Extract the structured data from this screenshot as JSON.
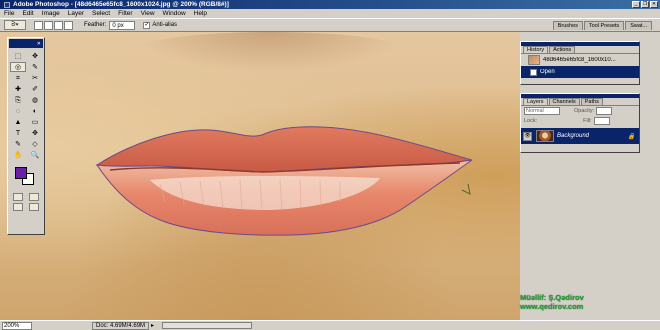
{
  "window": {
    "title": "Adobe Photoshop - [48d6465e65fc8_1600x1024.jpg @ 200% (RGB/8#)]",
    "buttons": [
      "_",
      "❐",
      "✕"
    ]
  },
  "menu": [
    "File",
    "Edit",
    "Image",
    "Layer",
    "Select",
    "Filter",
    "View",
    "Window",
    "Help"
  ],
  "options_bar": {
    "feather_label": "Feather:",
    "feather_value": "0 px",
    "antialias_label": "Anti-alias",
    "antialias_checked": "✓",
    "well_tabs": [
      "Brushes",
      "Tool Presets",
      "Swat..."
    ]
  },
  "toolbox": {
    "tools": [
      "⬚",
      "✥",
      "◎",
      "✎",
      "⌗",
      "✂",
      "✚",
      "✐",
      "⎘",
      "◍",
      "◌",
      "◐",
      "▲",
      "▭",
      "T",
      "✥",
      "✎",
      "◇",
      "✋",
      "🔍"
    ],
    "foreground_color": "#6a1fa8",
    "background_color": "#ffffff"
  },
  "history": {
    "tabs": [
      "History",
      "Actions"
    ],
    "snapshot_label": "48d6465e65fc8_1600x10...",
    "items": [
      {
        "label": "Open"
      }
    ]
  },
  "layers": {
    "tabs": [
      "Layers",
      "Channels",
      "Paths"
    ],
    "blend_mode": "Normal",
    "opacity_label": "Opacity:",
    "lock_label": "Lock:",
    "fill_label": "Fill:",
    "layer_name": "Background",
    "lock_glyph": "🔒"
  },
  "status_bar": {
    "zoom": "200%",
    "doc": "Doc: 4.69M/4.69M",
    "arrow": "▸"
  },
  "watermark": {
    "line1": "Müəllif: Ş.Qədirov",
    "line2": "www.qedirov.com"
  }
}
